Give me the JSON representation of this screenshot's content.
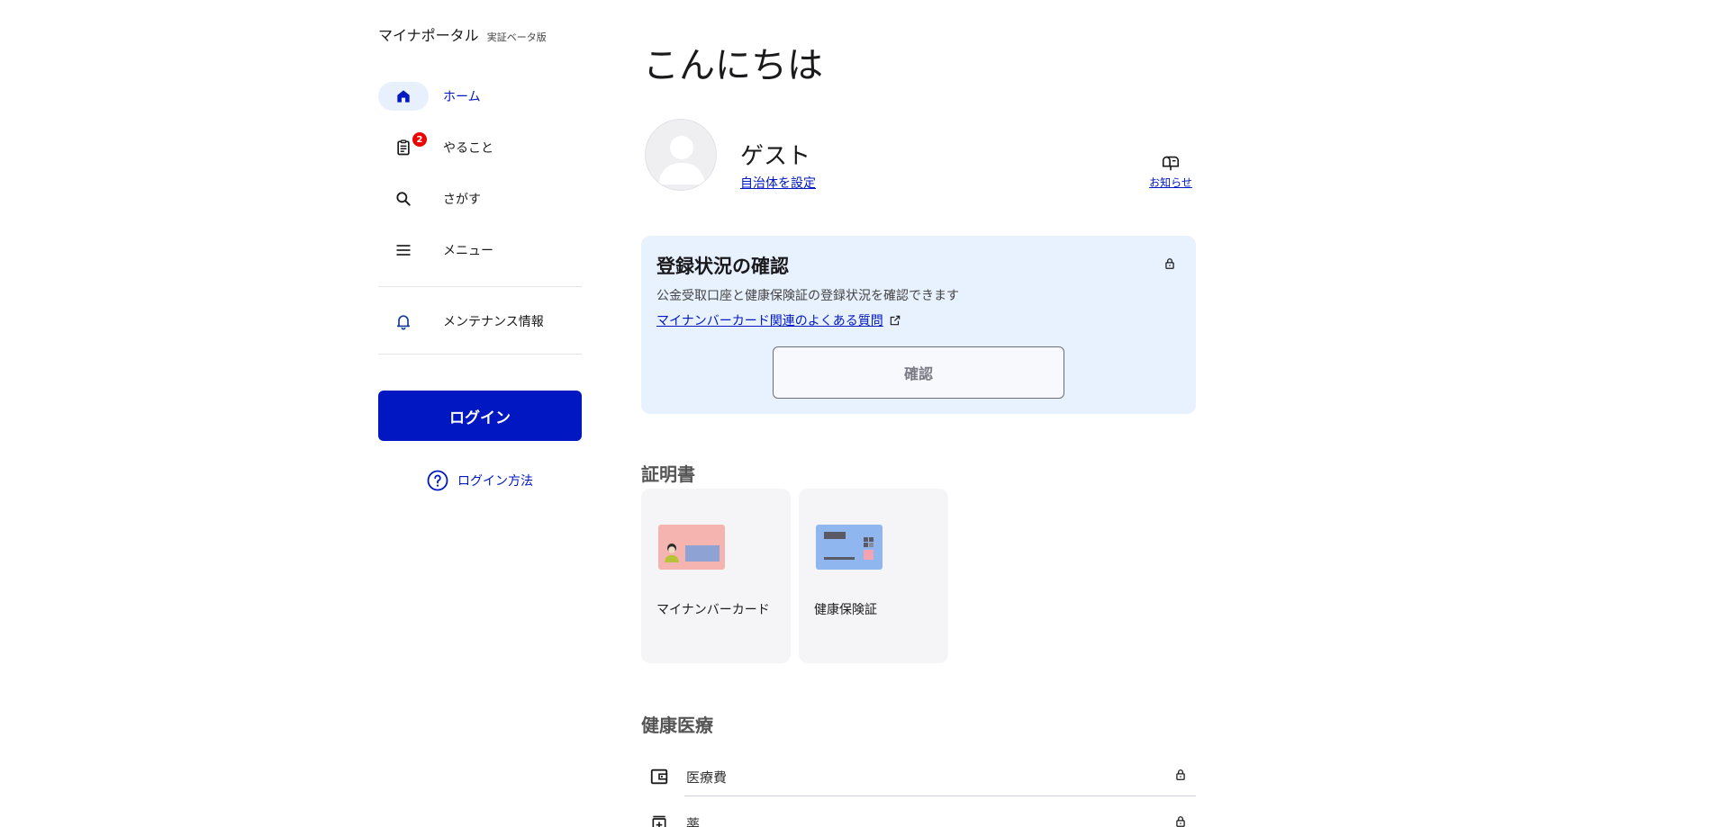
{
  "app": {
    "name": "マイナポータル",
    "tag": "実証ベータ版"
  },
  "sidebar": {
    "items": [
      {
        "label": "ホーム",
        "icon": "home-icon",
        "active": true
      },
      {
        "label": "やること",
        "icon": "clipboard-icon",
        "badge": "2"
      },
      {
        "label": "さがす",
        "icon": "search-icon"
      },
      {
        "label": "メニュー",
        "icon": "menu-icon"
      },
      {
        "label": "メンテナンス情報",
        "icon": "bell-icon"
      }
    ],
    "login_label": "ログイン",
    "login_help_label": "ログイン方法"
  },
  "main": {
    "title": "こんにちは",
    "user": {
      "name": "ゲスト",
      "link_label": "自治体を設定"
    },
    "notice_label": "お知らせ",
    "registration": {
      "title": "登録状況の確認",
      "description": "公金受取口座と健康保険証の登録状況を確認できます",
      "link_label": "マイナンバーカード関連のよくある質問",
      "button_label": "確認"
    },
    "certificates": {
      "heading": "証明書",
      "cards": [
        {
          "label": "マイナンバーカード"
        },
        {
          "label": "健康保険証"
        }
      ]
    },
    "health": {
      "heading": "健康医療",
      "rows": [
        {
          "label": "医療費",
          "icon": "wallet-icon"
        },
        {
          "label": "薬",
          "icon": "medicine-icon"
        }
      ]
    }
  },
  "colors": {
    "brand_blue": "#0017c1",
    "active_pill": "#e8f0fe",
    "card_bg": "#e8f1fe",
    "badge_red": "#ec0000"
  }
}
